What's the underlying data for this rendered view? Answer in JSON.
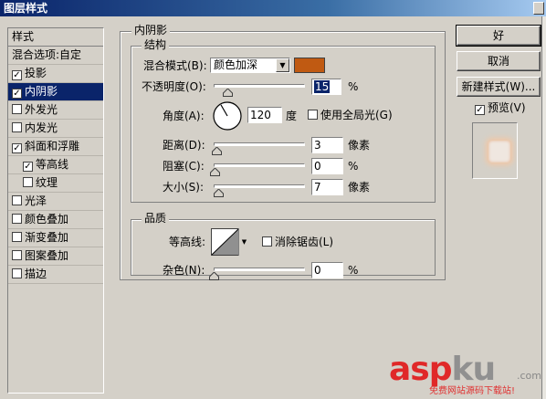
{
  "window": {
    "title": "图层样式"
  },
  "style_list": {
    "header": "样式",
    "items": [
      {
        "label": "混合选项:自定",
        "checkbox": false,
        "checked": false,
        "indent": false,
        "selected": false
      },
      {
        "label": "投影",
        "checkbox": true,
        "checked": true,
        "indent": false,
        "selected": false
      },
      {
        "label": "内阴影",
        "checkbox": true,
        "checked": true,
        "indent": false,
        "selected": true
      },
      {
        "label": "外发光",
        "checkbox": true,
        "checked": false,
        "indent": false,
        "selected": false
      },
      {
        "label": "内发光",
        "checkbox": true,
        "checked": false,
        "indent": false,
        "selected": false
      },
      {
        "label": "斜面和浮雕",
        "checkbox": true,
        "checked": true,
        "indent": false,
        "selected": false
      },
      {
        "label": "等高线",
        "checkbox": true,
        "checked": true,
        "indent": true,
        "selected": false
      },
      {
        "label": "纹理",
        "checkbox": true,
        "checked": false,
        "indent": true,
        "selected": false
      },
      {
        "label": "光泽",
        "checkbox": true,
        "checked": false,
        "indent": false,
        "selected": false
      },
      {
        "label": "颜色叠加",
        "checkbox": true,
        "checked": false,
        "indent": false,
        "selected": false
      },
      {
        "label": "渐变叠加",
        "checkbox": true,
        "checked": false,
        "indent": false,
        "selected": false
      },
      {
        "label": "图案叠加",
        "checkbox": true,
        "checked": false,
        "indent": false,
        "selected": false
      },
      {
        "label": "描边",
        "checkbox": true,
        "checked": false,
        "indent": false,
        "selected": false
      }
    ]
  },
  "inner_shadow": {
    "group_title": "内阴影",
    "structure": {
      "title": "结构",
      "blend_mode_label": "混合模式(B):",
      "blend_mode_value": "颜色加深",
      "shadow_color": "#c05a12",
      "opacity_label": "不透明度(O):",
      "opacity_value": "15",
      "opacity_unit": "%",
      "opacity_level": 0.15,
      "angle_label": "角度(A):",
      "angle_value": "120",
      "angle_unit": "度",
      "global_light_label": "使用全局光(G)",
      "global_light_checked": false,
      "distance_label": "距离(D):",
      "distance_value": "3",
      "distance_unit": "像素",
      "choke_label": "阻塞(C):",
      "choke_value": "0",
      "choke_unit": "%",
      "size_label": "大小(S):",
      "size_value": "7",
      "size_unit": "像素"
    },
    "quality": {
      "title": "品质",
      "contour_label": "等高线:",
      "anti_alias_label": "消除锯齿(L)",
      "anti_alias_checked": false,
      "noise_label": "杂色(N):",
      "noise_value": "0",
      "noise_unit": "%"
    }
  },
  "buttons": {
    "ok": "好",
    "cancel": "取消",
    "new_style": "新建样式(W)...",
    "preview_label": "预览(V)",
    "preview_checked": true
  },
  "watermark": {
    "logo_part1": "asp",
    "logo_part2": "ku",
    "suffix": ".com",
    "tagline": "免费网站源码下载站!"
  }
}
